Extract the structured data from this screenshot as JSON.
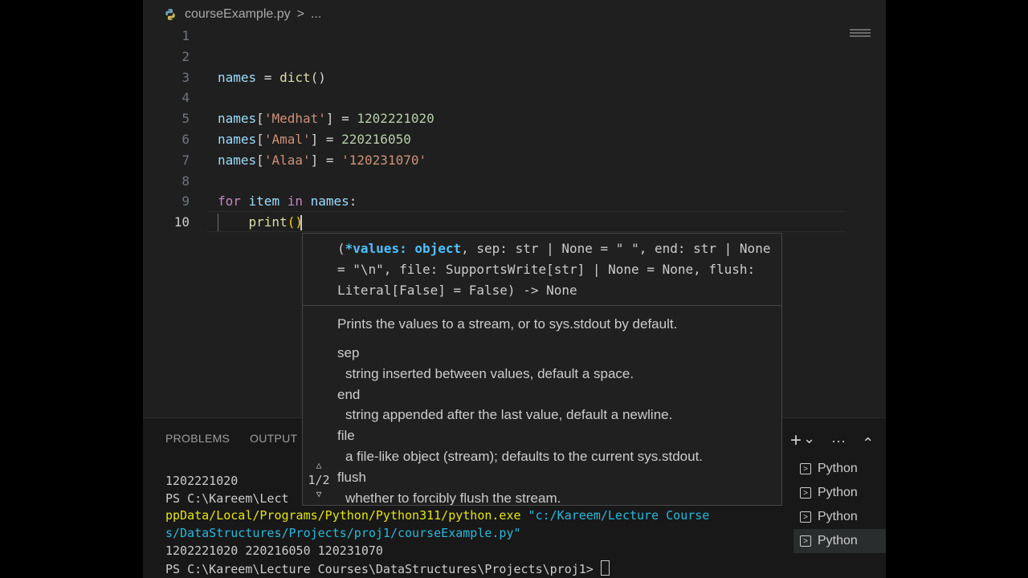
{
  "breadcrumb": {
    "file": "courseExample.py",
    "separator": ">",
    "more": "..."
  },
  "editor": {
    "active_line": 10,
    "lines": [
      {
        "num": "1",
        "tokens": []
      },
      {
        "num": "2",
        "tokens": []
      },
      {
        "num": "3",
        "tokens": [
          {
            "t": "names",
            "c": "v"
          },
          {
            "t": " = ",
            "c": "p"
          },
          {
            "t": "dict",
            "c": "f"
          },
          {
            "t": "()",
            "c": "p"
          }
        ]
      },
      {
        "num": "4",
        "tokens": []
      },
      {
        "num": "5",
        "tokens": [
          {
            "t": "names",
            "c": "v"
          },
          {
            "t": "[",
            "c": "p"
          },
          {
            "t": "'Medhat'",
            "c": "s"
          },
          {
            "t": "] = ",
            "c": "p"
          },
          {
            "t": "1202221020",
            "c": "n"
          }
        ]
      },
      {
        "num": "6",
        "tokens": [
          {
            "t": "names",
            "c": "v"
          },
          {
            "t": "[",
            "c": "p"
          },
          {
            "t": "'Amal'",
            "c": "s"
          },
          {
            "t": "] = ",
            "c": "p"
          },
          {
            "t": "220216050",
            "c": "n"
          }
        ]
      },
      {
        "num": "7",
        "tokens": [
          {
            "t": "names",
            "c": "v"
          },
          {
            "t": "[",
            "c": "p"
          },
          {
            "t": "'Alaa'",
            "c": "s"
          },
          {
            "t": "] = ",
            "c": "p"
          },
          {
            "t": "'120231070'",
            "c": "s"
          }
        ]
      },
      {
        "num": "8",
        "tokens": []
      },
      {
        "num": "9",
        "tokens": [
          {
            "t": "for",
            "c": "k"
          },
          {
            "t": " item ",
            "c": "v"
          },
          {
            "t": "in",
            "c": "k"
          },
          {
            "t": " names",
            "c": "v"
          },
          {
            "t": ":",
            "c": "p"
          }
        ]
      },
      {
        "num": "10",
        "tokens": [
          {
            "t": "    ",
            "c": "p"
          },
          {
            "t": "print",
            "c": "f"
          },
          {
            "t": "()",
            "c": "br"
          }
        ]
      }
    ]
  },
  "signature_help": {
    "params_prefix": "(",
    "active_param": "*values: object",
    "signature_rest": ", sep: str | None = \" \", end: str | None = \"\\n\", file: SupportsWrite[str] | None = None, flush: Literal[False] = False) -> None",
    "summary": "Prints the values to a stream, or to sys.stdout by default.",
    "params": [
      {
        "name": "sep",
        "desc": "string inserted between values, default a space."
      },
      {
        "name": "end",
        "desc": "string appended after the last value, default a newline."
      },
      {
        "name": "file",
        "desc": "a file-like object (stream); defaults to the current sys.stdout."
      },
      {
        "name": "flush",
        "desc": "whether to forcibly flush the stream."
      }
    ],
    "overload": "1/2"
  },
  "panel": {
    "tabs": [
      "PROBLEMS",
      "OUTPUT"
    ],
    "terminal": {
      "line1": "1202221020",
      "line2": "PS C:\\Kareem\\Lect",
      "line3_yellow": "ppData/Local/Programs/Python/Python311/python.exe",
      "line3_cyan": " \"c:/Kareem/Lecture Course",
      "line4_cyan": "s/DataStructures/Projects/proj1/courseExample.py\"",
      "line5": "1202221020 220216050 120231070",
      "line6": "PS C:\\Kareem\\Lecture Courses\\DataStructures\\Projects\\proj1> "
    },
    "terminals": [
      "Python",
      "Python",
      "Python",
      "Python"
    ],
    "actions": {
      "add": "+",
      "dropdown": "⌄",
      "more": "···",
      "maximize": "⌃"
    }
  }
}
